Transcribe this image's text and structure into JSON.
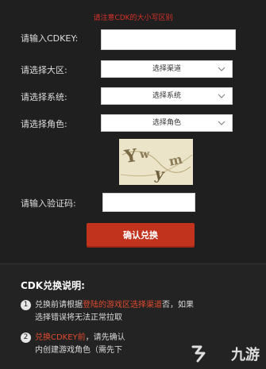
{
  "notice": "请注意CDK的大小写区别",
  "form": {
    "cdkey_label": "请输入CDKEY:",
    "region_label": "请选择大区:",
    "region_value": "选择渠道",
    "system_label": "请选择系统:",
    "system_value": "选择系统",
    "role_label": "请选择角色:",
    "role_value": "选择角色",
    "captcha_text": "Yw y m",
    "verify_label": "请输入验证码:",
    "confirm_button": "确认兑换"
  },
  "instructions": {
    "title": "CDK兑换说明:",
    "item1_num": "1",
    "item1_line1_a": "兑换前请根据",
    "item1_line1_red": "登陆的游戏区选择渠道",
    "item1_line1_b": "否，如果",
    "item1_line2": "选择错误将无法正常拉取",
    "item2_num": "2",
    "item2_line1_red": "兑换CDKEY前",
    "item2_line1_b": "，请先确认",
    "item2_line2": "内创建游戏角色（需先下"
  },
  "watermark": "九游",
  "colors": {
    "accent": "#c2331d",
    "notice": "#d8302a"
  }
}
